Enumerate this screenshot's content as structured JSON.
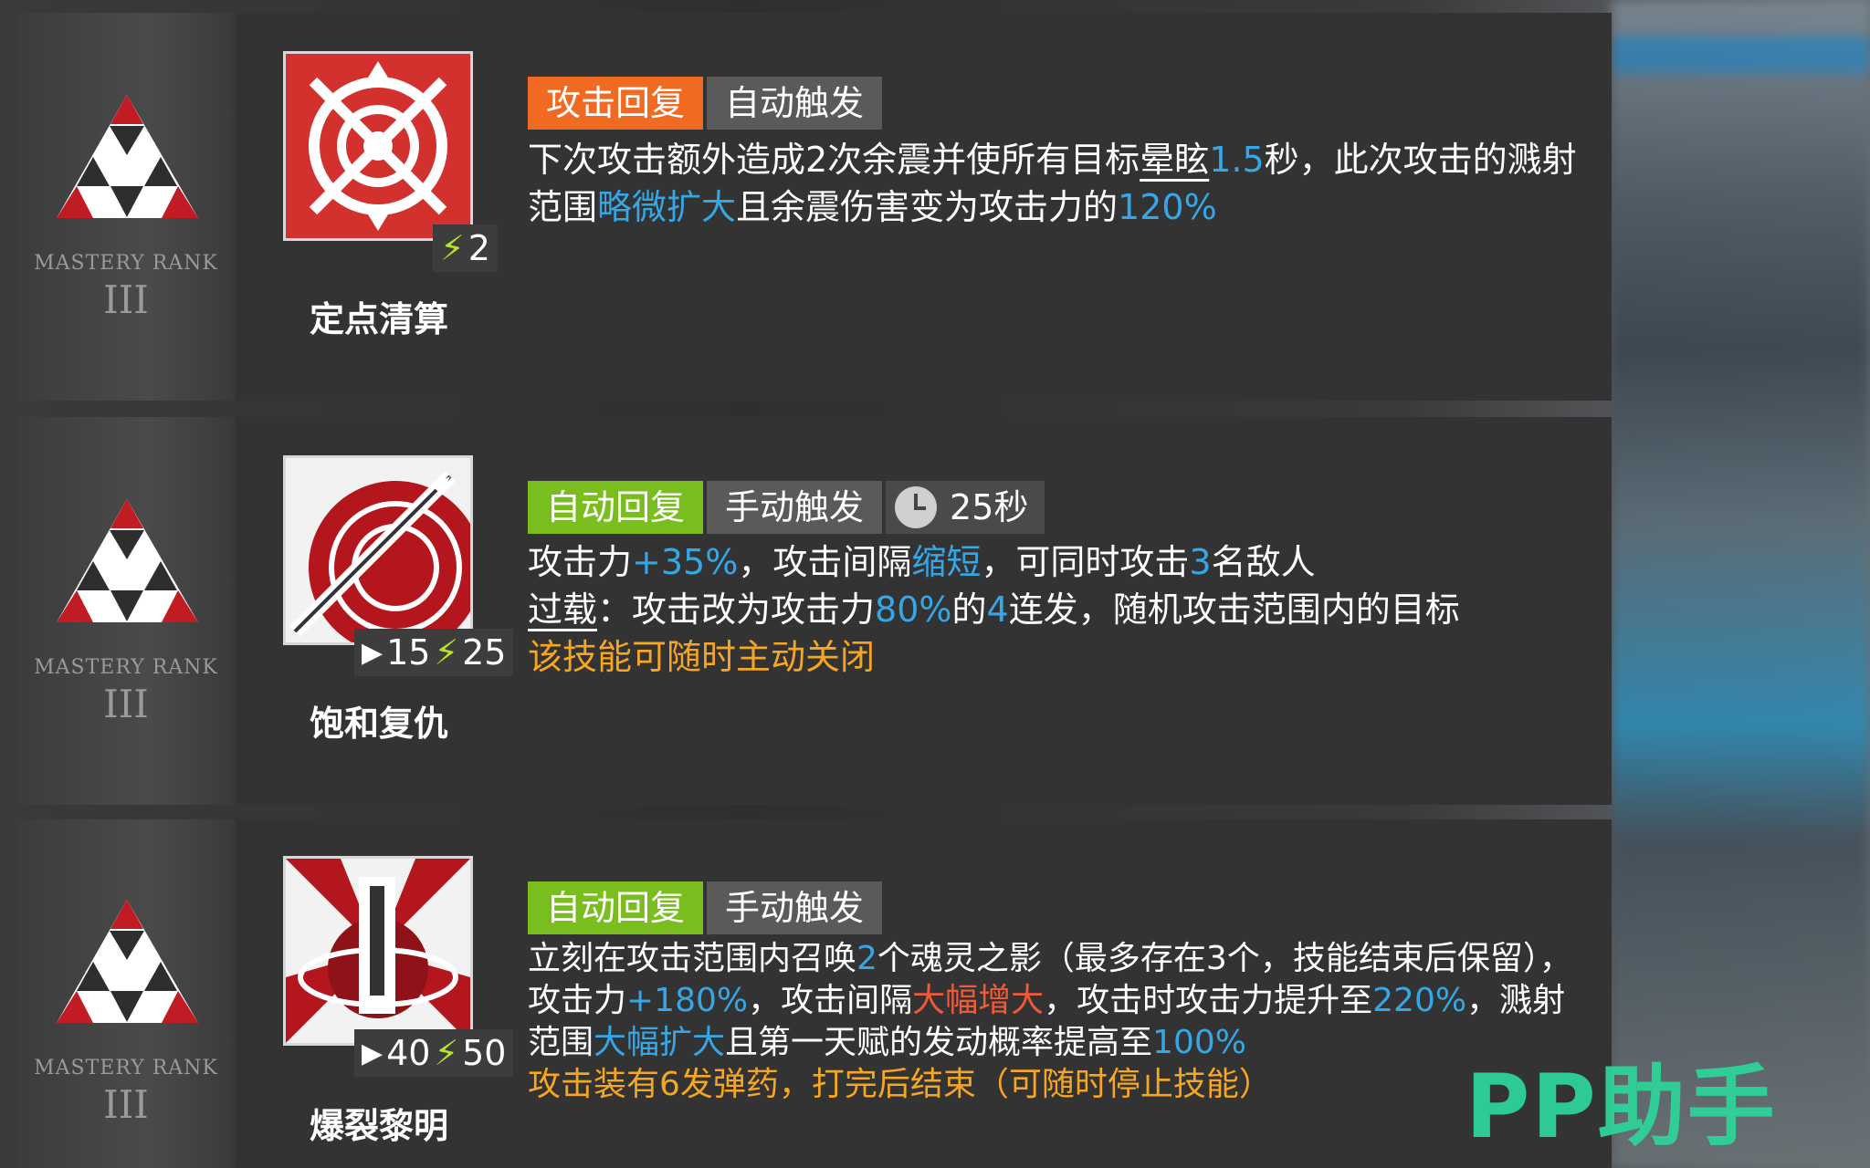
{
  "rows": [
    {
      "mastery_label": "MASTERY RANK",
      "mastery_rank": "III",
      "skill_name": "定点清算",
      "cost": "2",
      "tags": [
        "攻击回复",
        "自动触发"
      ],
      "desc": {
        "p1": "下次攻击额外造成2次余震并使所有目标",
        "p2": "晕眩",
        "p3": "1.5",
        "p4": "秒，此次攻击的溅射范围",
        "p5": "略微扩大",
        "p6": "且余震伤害变为攻击力的",
        "p7": "120%"
      }
    },
    {
      "mastery_label": "MASTERY RANK",
      "mastery_rank": "III",
      "skill_name": "饱和复仇",
      "initial": "15",
      "cost": "25",
      "tags": [
        "自动回复",
        "手动触发"
      ],
      "duration": "25秒",
      "desc": {
        "a1": "攻击力",
        "a2": "+35%",
        "a3": "，攻击间隔",
        "a4": "缩短",
        "a5": "，可同时攻击",
        "a6": "3",
        "a7": "名敌人",
        "b1": "过载",
        "b2": "：攻击改为攻击力",
        "b3": "80%",
        "b4": "的",
        "b5": "4",
        "b6": "连发，随机攻击范围内的目标",
        "note": "该技能可随时主动关闭"
      }
    },
    {
      "mastery_label": "MASTERY RANK",
      "mastery_rank": "III",
      "skill_name": "爆裂黎明",
      "initial": "40",
      "cost": "50",
      "tags": [
        "自动回复",
        "手动触发"
      ],
      "desc": {
        "c1": "立刻在攻击范围内召唤",
        "c2": "2",
        "c3": "个魂灵之影（最多存在3个，技能结束后保留），攻击力",
        "c4": "+180%",
        "c5": "，攻击间隔",
        "c6": "大幅增大",
        "c7": "，攻击时攻击力提升至",
        "c8": "220%",
        "c9": "，溅射范围",
        "c10": "大幅扩大",
        "c11": "且第一天赋的发动概率提高至",
        "c12": "100%",
        "note": "攻击装有6发弹药，打完后结束（可随时停止技能）"
      }
    }
  ],
  "watermark": "PP助手",
  "colors": {
    "orange_tag": "#f06a22",
    "green_tag": "#79bd1e",
    "gray_tag": "#5a5a5a",
    "highlight_blue": "#35a7e6",
    "highlight_red": "#f05a3a",
    "note_orange": "#f5a623",
    "bolt_green": "#b5e32a",
    "watermark_green": "#2ed39a"
  }
}
